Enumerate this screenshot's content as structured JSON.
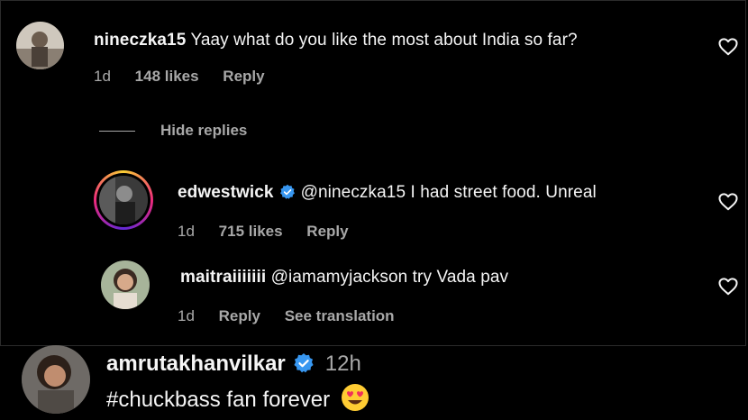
{
  "comments": [
    {
      "username": "nineczka15",
      "text": "Yaay what do you like the most about India so far?",
      "time": "1d",
      "likes": "148 likes",
      "reply_label": "Reply",
      "verified": false
    }
  ],
  "thread": {
    "hide_replies_label": "Hide replies",
    "replies": [
      {
        "username": "edwestwick",
        "text": "@nineczka15 I had street food. Unreal",
        "time": "1d",
        "likes": "715 likes",
        "reply_label": "Reply",
        "verified": true,
        "story_ring": true
      },
      {
        "username": "maitraiiiiiii",
        "text": "@iamamyjackson try Vada pav",
        "time": "1d",
        "reply_label": "Reply",
        "see_translation_label": "See translation",
        "verified": false
      }
    ]
  },
  "overlay_comment": {
    "username": "amrutakhanvilkar",
    "time": "12h",
    "text": "#chuckbass fan forever",
    "verified": true,
    "emoji": "smiling-face-with-heart-eyes"
  },
  "icons": {
    "like": "heart-outline-icon",
    "verified": "verified-badge-icon"
  },
  "colors": {
    "background": "#000000",
    "primary_text": "#f5f5f5",
    "secondary_text": "#a8a8a8",
    "verified": "#3897f0"
  }
}
